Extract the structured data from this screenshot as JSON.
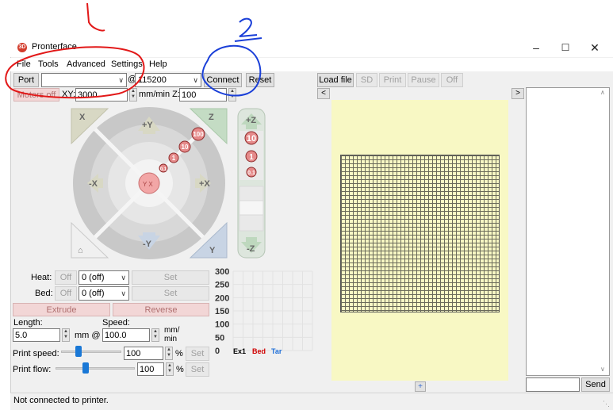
{
  "window": {
    "title": "Pronterface",
    "minimize_icon": "minimize-icon",
    "maximize_icon": "maximize-icon",
    "close_icon": "close-icon"
  },
  "annotations": {
    "one": "1",
    "two": "2"
  },
  "menu": {
    "items": [
      "File",
      "Tools",
      "Advanced",
      "Settings",
      "Help"
    ]
  },
  "toolbar": {
    "port_label": "Port",
    "port_value": "",
    "at": "@",
    "baud_value": "115200",
    "connect_label": "Connect",
    "reset_label": "Reset",
    "motors_off_label": "Motors off",
    "xy_label": "XY:",
    "xy_value": "3000",
    "xy_unit": "mm/min Z:",
    "z_value": "100"
  },
  "printbar": {
    "load_file": "Load file",
    "sd": "SD",
    "print": "Print",
    "pause": "Pause",
    "off": "Off"
  },
  "jog": {
    "home_x": "X",
    "home_z": "Z",
    "plus_y": "+Y",
    "minus_y": "-Y",
    "plus_x": "+X",
    "minus_x": "-X",
    "home_y": "Y",
    "plus_z": "+Z",
    "minus_z": "-Z",
    "steps_xy": [
      "100",
      "10",
      "1",
      "0.1"
    ],
    "steps_z": [
      "10",
      "1",
      "0.1"
    ],
    "center": "Y X"
  },
  "temps": {
    "heat_label": "Heat:",
    "heat_off": "Off",
    "heat_value": "0 (off)",
    "heat_set": "Set",
    "bed_label": "Bed:",
    "bed_off": "Off",
    "bed_value": "0 (off)",
    "bed_set": "Set"
  },
  "extrude": {
    "extrude_label": "Extrude",
    "reverse_label": "Reverse",
    "length_label": "Length:",
    "speed_label": "Speed:",
    "length_value": "5.0",
    "length_unit": "mm @",
    "speed_value": "100.0",
    "speed_unit_top": "mm/",
    "speed_unit_bottom": "min"
  },
  "print_speed": {
    "label": "Print speed:",
    "value": "100",
    "pct": "%",
    "set": "Set",
    "level": 0.29
  },
  "print_flow": {
    "label": "Print flow:",
    "value": "100",
    "pct": "%",
    "set": "Set",
    "level": 0.38
  },
  "chart_data": {
    "type": "line",
    "yticks": [
      "300",
      "250",
      "200",
      "150",
      "100",
      "50",
      "0"
    ],
    "legend": [
      {
        "name": "Ex1",
        "color": "#000000"
      },
      {
        "name": "Bed",
        "color": "#d00000"
      },
      {
        "name": "Tar",
        "color": "#1e6fd9"
      }
    ],
    "series": []
  },
  "nav": {
    "left": "<",
    "right": ">",
    "plus": "+"
  },
  "console": {
    "send_label": "Send",
    "input_value": ""
  },
  "status": {
    "text": "Not connected to printer."
  }
}
